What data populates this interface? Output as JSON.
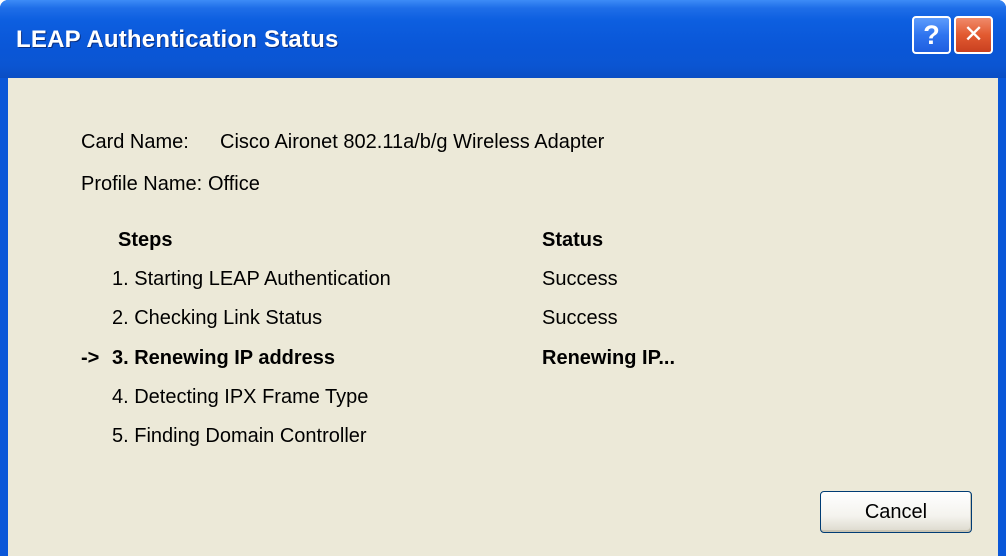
{
  "window": {
    "title": "LEAP Authentication Status",
    "help_label": "?",
    "close_label": "✕"
  },
  "info": {
    "card_label": "Card Name:",
    "card_value": "Cisco Aironet 802.11a/b/g Wireless Adapter",
    "profile_label": "Profile Name:",
    "profile_value": "Office"
  },
  "steps_header": "Steps",
  "status_header": "Status",
  "current_marker": "->",
  "steps": [
    {
      "label": "1. Starting LEAP Authentication",
      "status": "Success"
    },
    {
      "label": "2. Checking Link Status",
      "status": "Success"
    },
    {
      "label": "3. Renewing IP address",
      "status": "Renewing IP..."
    },
    {
      "label": "4. Detecting IPX Frame Type",
      "status": ""
    },
    {
      "label": "5. Finding Domain Controller",
      "status": ""
    }
  ],
  "cancel_label": "Cancel"
}
